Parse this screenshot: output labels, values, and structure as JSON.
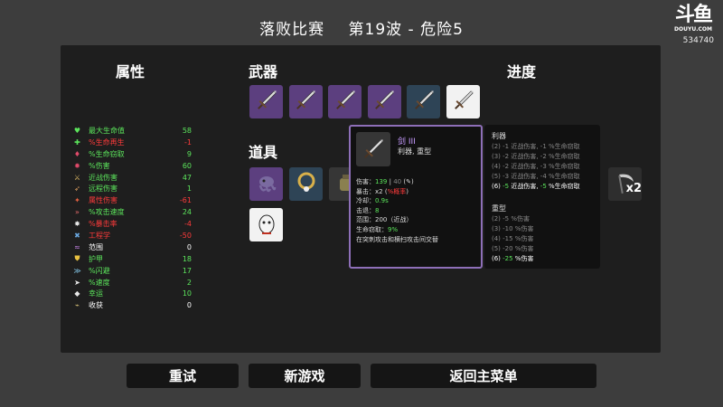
{
  "header": {
    "title_left": "落败比赛",
    "title_right": "第19波 - 危险5"
  },
  "logo": {
    "mark": "斗鱼",
    "domain": "DOUYU.COM",
    "room_id": "534740"
  },
  "sections": {
    "stats": "属性",
    "weapons": "武器",
    "items": "道具",
    "progress": "进度"
  },
  "stats": [
    {
      "icon": "heart-icon",
      "label": "最大生命值",
      "value": "58",
      "color": "#5ce65c"
    },
    {
      "icon": "health-regen-icon",
      "label": "%生命再生",
      "value": "-1",
      "color": "#ff3b3b"
    },
    {
      "icon": "lifesteal-icon",
      "label": "%生命窃取",
      "value": "9",
      "color": "#5ce65c"
    },
    {
      "icon": "damage-icon",
      "label": "%伤害",
      "value": "60",
      "color": "#5ce65c"
    },
    {
      "icon": "melee-damage-icon",
      "label": "近战伤害",
      "value": "47",
      "color": "#5ce65c"
    },
    {
      "icon": "ranged-damage-icon",
      "label": "远程伤害",
      "value": "1",
      "color": "#5ce65c"
    },
    {
      "icon": "elemental-damage-icon",
      "label": "属性伤害",
      "value": "-61",
      "color": "#ff3b3b"
    },
    {
      "icon": "attack-speed-icon",
      "label": "%攻击速度",
      "value": "24",
      "color": "#5ce65c"
    },
    {
      "icon": "crit-chance-icon",
      "label": "%暴击率",
      "value": "-4",
      "color": "#ff3b3b"
    },
    {
      "icon": "engineering-icon",
      "label": "工程学",
      "value": "-50",
      "color": "#ff3b3b"
    },
    {
      "icon": "range-icon",
      "label": "范围",
      "value": "0",
      "color": "#ffffff"
    },
    {
      "icon": "armor-icon",
      "label": "护甲",
      "value": "18",
      "color": "#5ce65c"
    },
    {
      "icon": "dodge-icon",
      "label": "%闪避",
      "value": "17",
      "color": "#5ce65c"
    },
    {
      "icon": "speed-icon",
      "label": "%速度",
      "value": "2",
      "color": "#5ce65c"
    },
    {
      "icon": "luck-icon",
      "label": "幸运",
      "value": "10",
      "color": "#5ce65c"
    },
    {
      "icon": "harvesting-icon",
      "label": "收获",
      "value": "0",
      "color": "#ffffff"
    }
  ],
  "weapons": [
    {
      "icon": "sword-icon",
      "tier_color": "#5c3f7f"
    },
    {
      "icon": "sword-icon",
      "tier_color": "#5c3f7f"
    },
    {
      "icon": "sword-icon",
      "tier_color": "#5c3f7f"
    },
    {
      "icon": "sword-icon",
      "tier_color": "#5c3f7f"
    },
    {
      "icon": "sword-icon",
      "tier_color": "#2e4456"
    },
    {
      "icon": "sword-icon",
      "tier_color": "#f2f2f2"
    }
  ],
  "items": [
    {
      "icon": "tentacle-item-icon",
      "tier_color": "#5c3f7f"
    },
    {
      "icon": "ring-item-icon",
      "tier_color": "#2e4456"
    },
    {
      "icon": "bag-item-icon",
      "tier_color": "#363636"
    },
    {
      "icon": "egg-item-icon",
      "tier_color": "#f2f2f2"
    },
    {
      "icon": "scythe-item-icon",
      "tier_color": "#2e2e2e",
      "count": "x2"
    }
  ],
  "tooltip": {
    "name": "剑 III",
    "classes": "利器, 重型",
    "damage_label": "伤害：",
    "damage_value": "139",
    "damage_base": "40",
    "crit_label": "暴击：",
    "crit_value": "x2",
    "crit_note": "%概率",
    "cooldown_label": "冷却：",
    "cooldown_value": "0.9s",
    "knockback_label": "击退：",
    "knockback_value": "8",
    "range_label": "范围：",
    "range_value": "200（近战）",
    "lifesteal_label": "生命窃取：",
    "lifesteal_value": "9%",
    "effect": "在突刺攻击和横扫攻击间交替"
  },
  "sets": [
    {
      "name": "利器",
      "lines": [
        "(2) -1 近战伤害, -1 %生命窃取",
        "(3) -2 近战伤害, -2 %生命窃取",
        "(4) -2 近战伤害, -3 %生命窃取",
        "(5) -3 近战伤害, -4 %生命窃取"
      ],
      "active_prefix": "(6) ",
      "active_a": "-5",
      "active_mid": " 近战伤害, ",
      "active_b": "-5",
      "active_suffix": " %生命窃取"
    },
    {
      "name": "重型",
      "lines": [
        "(2) -5 %伤害",
        "(3) -10 %伤害",
        "(4) -15 %伤害",
        "(5) -20 %伤害"
      ],
      "active_prefix": "(6) ",
      "active_a": "-25",
      "active_mid": " %伤害",
      "active_b": "",
      "active_suffix": ""
    }
  ],
  "buttons": {
    "retry": "重试",
    "new_game": "新游戏",
    "main_menu": "返回主菜单"
  }
}
